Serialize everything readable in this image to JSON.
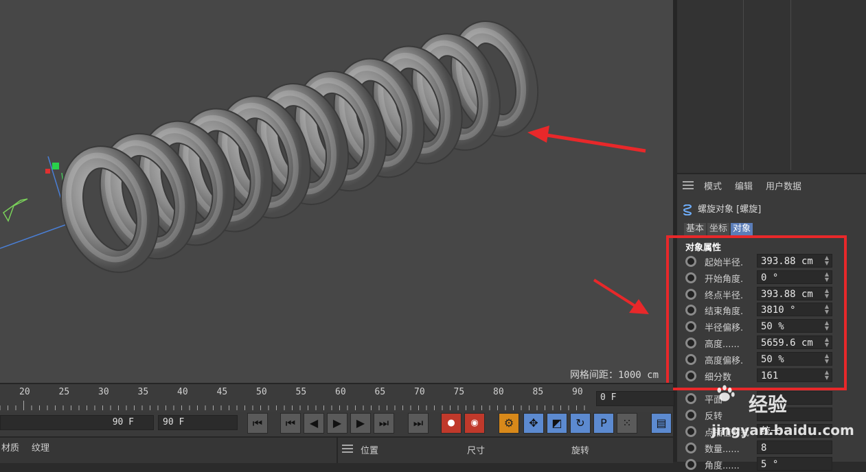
{
  "viewport": {
    "grid_spacing_label": "网格间距：1000 cm"
  },
  "attributes": {
    "menu": [
      "模式",
      "编辑",
      "用户数据"
    ],
    "object_title": "螺旋对象 [螺旋]",
    "tabs": [
      {
        "label": "基本",
        "active": false
      },
      {
        "label": "坐标",
        "active": false
      },
      {
        "label": "对象",
        "active": true
      }
    ],
    "section_title": "对象属性",
    "properties": [
      {
        "label": "起始半径.",
        "value": "393.88 cm"
      },
      {
        "label": "开始角度.",
        "value": "0 °"
      },
      {
        "label": "终点半径.",
        "value": "393.88 cm"
      },
      {
        "label": "结束角度.",
        "value": "3810 °"
      },
      {
        "label": "半径偏移.",
        "value": "50 %"
      },
      {
        "label": "高度......",
        "value": "5659.6 cm"
      },
      {
        "label": "高度偏移.",
        "value": "50 %"
      },
      {
        "label": "细分数",
        "value": "161"
      }
    ],
    "lower_rows": [
      {
        "label": "平面",
        "value": ""
      },
      {
        "label": "反转",
        "value": ""
      },
      {
        "label": "点插值方式",
        "value": "统一"
      },
      {
        "label": "数量......",
        "value": "8"
      },
      {
        "label": "角度......",
        "value": "5 °"
      }
    ]
  },
  "timeline": {
    "ticks": [
      "20",
      "25",
      "30",
      "35",
      "40",
      "45",
      "50",
      "55",
      "60",
      "65",
      "70",
      "75",
      "80",
      "85",
      "90"
    ],
    "current_frame": "0 F"
  },
  "transport": {
    "end_frame_a": "90 F",
    "end_frame_b": "90 F"
  },
  "bottom": {
    "left_tabs": [
      "材质",
      "纹理"
    ],
    "coord_headers": [
      "位置",
      "尺寸",
      "旋转"
    ]
  },
  "watermark": {
    "text": "经验",
    "url": "jingyan.baidu.com"
  },
  "colors": {
    "highlight": "#e8282a",
    "active_tab": "#5b7db8",
    "accent_blue": "#5c8ad0"
  }
}
